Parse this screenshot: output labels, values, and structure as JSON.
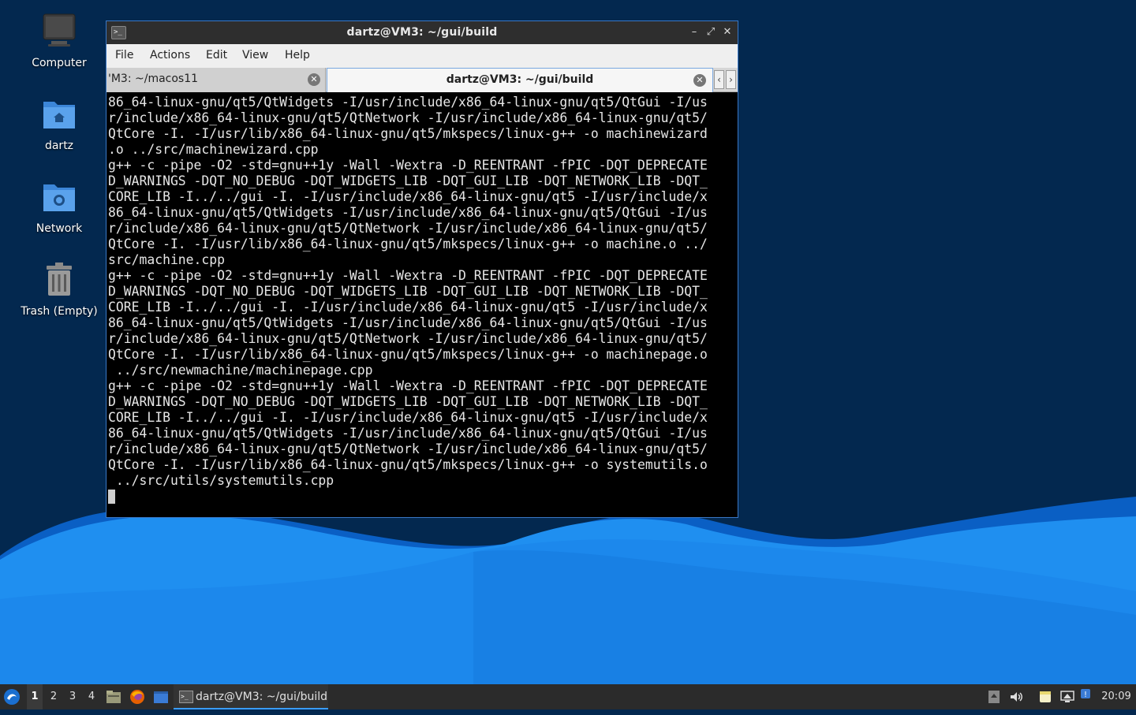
{
  "desktop": {
    "icons": [
      {
        "label": "Computer",
        "icon": "computer-icon"
      },
      {
        "label": "dartz",
        "icon": "home-folder-icon"
      },
      {
        "label": "Network",
        "icon": "network-folder-icon"
      },
      {
        "label": "Trash (Empty)",
        "icon": "trash-icon"
      }
    ]
  },
  "window": {
    "title": "dartz@VM3: ~/gui/build",
    "buttons": {
      "minimize": "–",
      "maximize": "⤢",
      "close": "✕"
    },
    "menu": [
      "File",
      "Actions",
      "Edit",
      "View",
      "Help"
    ],
    "tabs": [
      {
        "label": "'M3: ~/macos11",
        "active": false
      },
      {
        "label": "dartz@VM3: ~/gui/build",
        "active": true
      }
    ],
    "tab_nav": {
      "prev": "‹",
      "next": "›"
    }
  },
  "terminal": {
    "lines": [
      "86_64-linux-gnu/qt5/QtWidgets -I/usr/include/x86_64-linux-gnu/qt5/QtGui -I/us",
      "r/include/x86_64-linux-gnu/qt5/QtNetwork -I/usr/include/x86_64-linux-gnu/qt5/",
      "QtCore -I. -I/usr/lib/x86_64-linux-gnu/qt5/mkspecs/linux-g++ -o machinewizard",
      ".o ../src/machinewizard.cpp",
      "g++ -c -pipe -O2 -std=gnu++1y -Wall -Wextra -D_REENTRANT -fPIC -DQT_DEPRECATE",
      "D_WARNINGS -DQT_NO_DEBUG -DQT_WIDGETS_LIB -DQT_GUI_LIB -DQT_NETWORK_LIB -DQT_",
      "CORE_LIB -I../../gui -I. -I/usr/include/x86_64-linux-gnu/qt5 -I/usr/include/x",
      "86_64-linux-gnu/qt5/QtWidgets -I/usr/include/x86_64-linux-gnu/qt5/QtGui -I/us",
      "r/include/x86_64-linux-gnu/qt5/QtNetwork -I/usr/include/x86_64-linux-gnu/qt5/",
      "QtCore -I. -I/usr/lib/x86_64-linux-gnu/qt5/mkspecs/linux-g++ -o machine.o ../",
      "src/machine.cpp",
      "g++ -c -pipe -O2 -std=gnu++1y -Wall -Wextra -D_REENTRANT -fPIC -DQT_DEPRECATE",
      "D_WARNINGS -DQT_NO_DEBUG -DQT_WIDGETS_LIB -DQT_GUI_LIB -DQT_NETWORK_LIB -DQT_",
      "CORE_LIB -I../../gui -I. -I/usr/include/x86_64-linux-gnu/qt5 -I/usr/include/x",
      "86_64-linux-gnu/qt5/QtWidgets -I/usr/include/x86_64-linux-gnu/qt5/QtGui -I/us",
      "r/include/x86_64-linux-gnu/qt5/QtNetwork -I/usr/include/x86_64-linux-gnu/qt5/",
      "QtCore -I. -I/usr/lib/x86_64-linux-gnu/qt5/mkspecs/linux-g++ -o machinepage.o",
      " ../src/newmachine/machinepage.cpp",
      "g++ -c -pipe -O2 -std=gnu++1y -Wall -Wextra -D_REENTRANT -fPIC -DQT_DEPRECATE",
      "D_WARNINGS -DQT_NO_DEBUG -DQT_WIDGETS_LIB -DQT_GUI_LIB -DQT_NETWORK_LIB -DQT_",
      "CORE_LIB -I../../gui -I. -I/usr/include/x86_64-linux-gnu/qt5 -I/usr/include/x",
      "86_64-linux-gnu/qt5/QtWidgets -I/usr/include/x86_64-linux-gnu/qt5/QtGui -I/us",
      "r/include/x86_64-linux-gnu/qt5/QtNetwork -I/usr/include/x86_64-linux-gnu/qt5/",
      "QtCore -I. -I/usr/lib/x86_64-linux-gnu/qt5/mkspecs/linux-g++ -o systemutils.o",
      " ../src/utils/systemutils.cpp"
    ]
  },
  "taskbar": {
    "workspaces": [
      "1",
      "2",
      "3",
      "4"
    ],
    "active_workspace": "1",
    "launchers": [
      "file-manager-icon",
      "firefox-icon",
      "show-desktop-icon"
    ],
    "task": {
      "label": "dartz@VM3: ~/gui/build",
      "icon": "terminal-icon"
    },
    "tray": [
      "clipboard-icon",
      "volume-icon",
      "notes-icon",
      "network-tray-icon",
      "update-icon"
    ],
    "clock": "20:09"
  },
  "colors": {
    "desktop_bg": "#03284f",
    "wave_light": "#1f8ff0",
    "wave_dark": "#0a5fc4",
    "window_border": "#3a78c6",
    "titlebar": "#2e2e2e",
    "taskbar": "#2b2b2b",
    "accent": "#3a9cff"
  }
}
